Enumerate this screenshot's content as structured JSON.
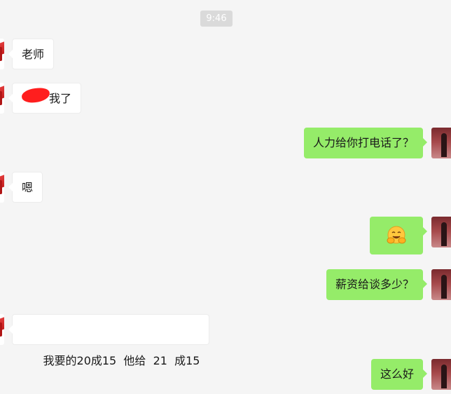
{
  "chat": {
    "timestamp": "9:46",
    "messages": [
      {
        "side": "left",
        "text": "老师"
      },
      {
        "side": "left",
        "text": "我了",
        "redacted": true
      },
      {
        "side": "right",
        "text": "人力给你打电话了？"
      },
      {
        "side": "left",
        "text": "嗯"
      },
      {
        "side": "right",
        "emoji": "hugging-face-emoji"
      },
      {
        "side": "right",
        "text": "薪资给谈多少？"
      },
      {
        "side": "left",
        "text": "我要的20成15  他给  21  成15"
      },
      {
        "side": "right",
        "text": "这么好"
      }
    ]
  },
  "colors": {
    "background": "#f5f5f5",
    "incoming_bubble": "#ffffff",
    "outgoing_bubble": "#95ec69",
    "timestamp_bg": "#dadada",
    "redaction": "#ff1e1e"
  }
}
